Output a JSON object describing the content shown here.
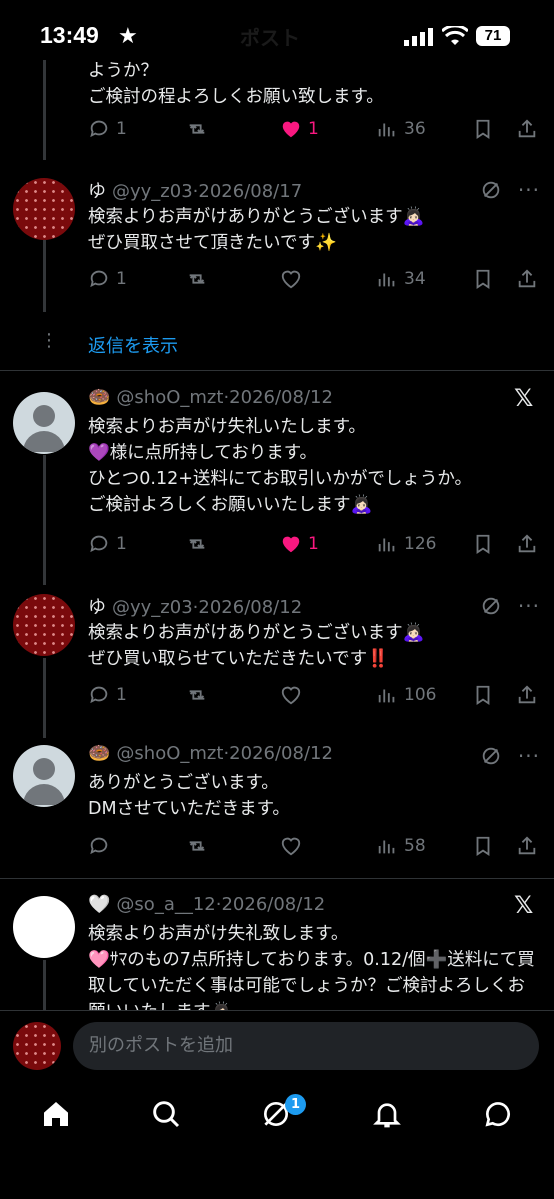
{
  "status_bar": {
    "time": "13:49",
    "title": "ポスト",
    "battery": "71"
  },
  "tweets": [
    {
      "partial_text": "ようか？\nご検討の程よろしくお願い致します。",
      "replies": "1",
      "likes": "1",
      "views": "36"
    },
    {
      "name": "ゆ",
      "handle": "@yy_z03",
      "date": "2026/08/17",
      "text": "検索よりお声がけありがとうございます🙇🏻‍♀️\nぜひ買取させて頂きたいです✨",
      "replies": "1",
      "likes": "",
      "views": "34"
    },
    {
      "name": "🍩",
      "handle": "@shoO_mzt",
      "date": "2026/08/12",
      "text": "検索よりお声がけ失礼いたします。\n💜様に点所持しております。\nひとつ0.12+送料にてお取引いかがでしょうか。\nご検討よろしくお願いいたします🙇🏻‍♀️",
      "replies": "1",
      "likes": "1",
      "views": "126"
    },
    {
      "name": "ゆ",
      "handle": "@yy_z03",
      "date": "2026/08/12",
      "text": "検索よりお声がけありがとうございます🙇🏻‍♀️\nぜひ買い取らせていただきたいです‼️",
      "replies": "1",
      "likes": "",
      "views": "106"
    },
    {
      "name": "🍩",
      "handle": "@shoO_mzt",
      "date": "2026/08/12",
      "text": "ありがとうございます。\nDMさせていただきます。",
      "replies": "",
      "likes": "",
      "views": "58"
    },
    {
      "name": "🤍",
      "handle": "@so_a__12",
      "date": "2026/08/12",
      "text": "検索よりお声がけ失礼致します。\n🩷ｻﾏのもの7点所持しております。0.12/個➕送料にて買取していただく事は可能でしょうか？ご検討よろしくお願いいたします🙇🏻‍♀️"
    }
  ],
  "show_replies": "返信を表示",
  "reply_placeholder": "別のポストを追加",
  "tabs": {
    "notif_badge": "1"
  },
  "colors": {
    "accent": "#1d9bf0",
    "like": "#f91880",
    "muted": "#71767b"
  }
}
